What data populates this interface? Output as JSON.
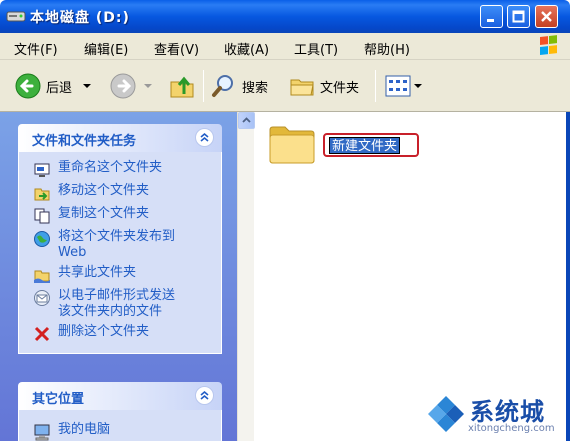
{
  "window": {
    "title": "本地磁盘 (D:)"
  },
  "menu": {
    "items": [
      "文件(F)",
      "编辑(E)",
      "查看(V)",
      "收藏(A)",
      "工具(T)",
      "帮助(H)"
    ]
  },
  "toolbar": {
    "back_label": "后退",
    "search_label": "搜索",
    "folders_label": "文件夹"
  },
  "task_pane": {
    "file_tasks": {
      "header": "文件和文件夹任务",
      "items": [
        {
          "label": "重命名这个文件夹",
          "icon": "rename-icon"
        },
        {
          "label": "移动这个文件夹",
          "icon": "move-icon"
        },
        {
          "label": "复制这个文件夹",
          "icon": "copy-icon"
        },
        {
          "label": "将这个文件夹发布到\nWeb",
          "icon": "publish-web-icon"
        },
        {
          "label": "共享此文件夹",
          "icon": "share-icon"
        },
        {
          "label": "以电子邮件形式发送\n该文件夹内的文件",
          "icon": "email-icon"
        },
        {
          "label": "删除这个文件夹",
          "icon": "delete-icon"
        }
      ]
    },
    "other_places": {
      "header": "其它位置",
      "items": [
        {
          "label": "我的电脑",
          "icon": "my-computer-icon"
        }
      ]
    }
  },
  "content": {
    "folder": {
      "name_value": "新建文件夹"
    }
  },
  "watermark": {
    "brand": "系统城",
    "url": "xitongcheng.com"
  },
  "colors": {
    "titlebar": "#0758e0",
    "task_link": "#215dc6",
    "selection": "#316ac5",
    "highlight_border": "#c8202a"
  }
}
